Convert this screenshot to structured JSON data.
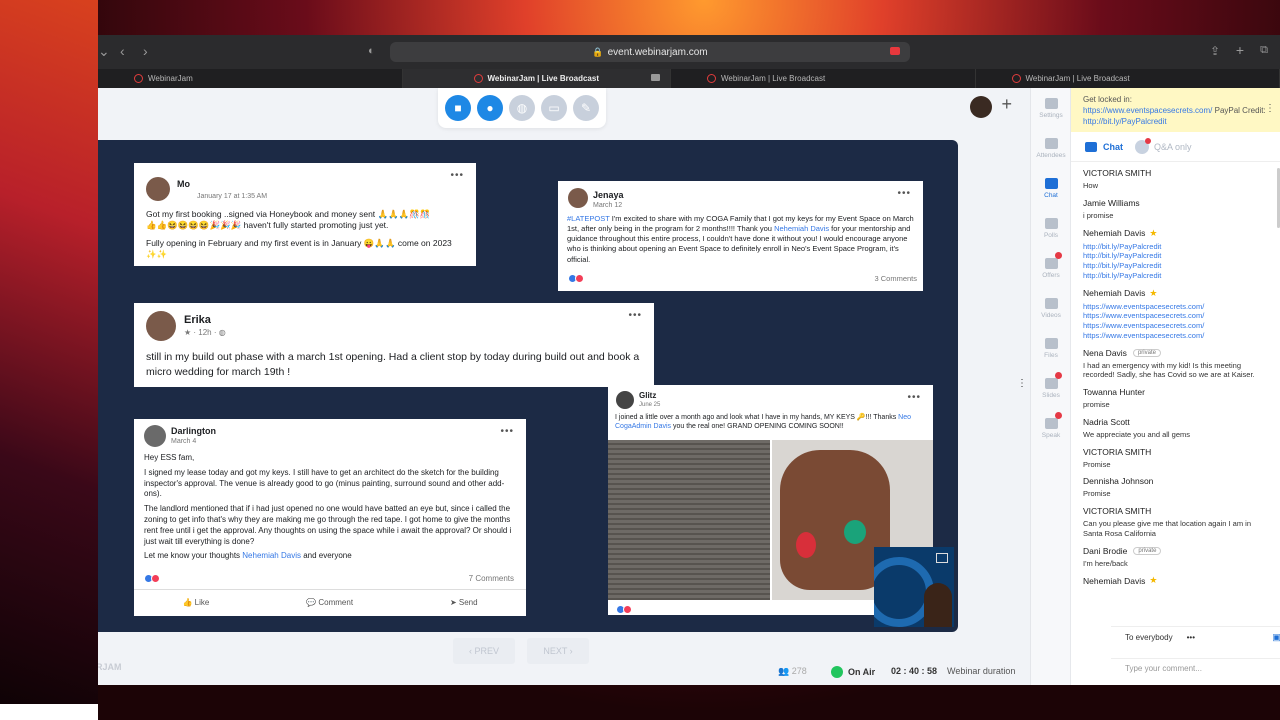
{
  "browser": {
    "url": "event.webinarjam.com",
    "tabs": [
      "WebinarJam",
      "WebinarJam | Live Broadcast",
      "WebinarJam | Live Broadcast",
      "WebinarJam | Live Broadcast"
    ]
  },
  "posts": {
    "mo": {
      "name": "Mo",
      "date": "January 17 at 1:35 AM",
      "line1": "Got my first booking ..signed via Honeybook and money sent 🙏🙏🙏🎊🎊",
      "line2": "👍👍😆😆😆😆🎉🎉🎉 haven't fully started promoting just yet.",
      "line3": "Fully opening in February and my first event is in January 😛🙏🙏 come on 2023 ✨✨"
    },
    "jenaya": {
      "name": "Jenaya",
      "date": "March 12",
      "tag": "#LATEPOST",
      "text1": " I'm excited to share with my COGA Family that I got my keys for my Event Space on March 1st, after only being in the program for 2 months!!!! Thank you ",
      "mention": "Nehemiah Davis",
      "text2": " for your mentorship and guidance throughout this entire process, I couldn't have done it without you! I would encourage anyone who is thinking about opening an Event Space to definitely enroll in Neo's Event Space Program,  it's official.",
      "comments": "3 Comments"
    },
    "erika": {
      "name": "Erika",
      "date": "12h",
      "text": "still in my build out phase with a march 1st opening. Had a client stop by today during build out and book a micro wedding for march 19th !"
    },
    "darlington": {
      "name": "Darlington",
      "date": "March 4",
      "p1": "Hey ESS fam,",
      "p2": "I signed my lease today and got my keys. I still have to get an architect do the sketch for the building inspector's approval. The venue is already good to go (minus painting, surround sound and other add-ons).",
      "p3": "The landlord mentioned that if i had just opened no one would have batted an eye but, since i called the zoning to get info that's why they are making me go through the red tape. I got home to give the months rent free until i get the approval.  Any thoughts on using the space while i await the approval? Or should i just wait till everything is done?",
      "p4a": "Let me know your thoughts  ",
      "mention": "Nehemiah Davis",
      "p4b": " and everyone",
      "comments": "7 Comments",
      "like": "Like",
      "comment": "Comment",
      "send": "Send"
    },
    "glitz": {
      "name": "Glitz",
      "date": "June 25",
      "text1": "I joined a little over a month ago and look what I have in my hands, MY KEYS 🔑!!! Thanks ",
      "mention": "Neo CogaAdmin Davis",
      "text2": " you the real one! GRAND OPENING COMING SOON!!"
    }
  },
  "bottom": {
    "prev": "PREV",
    "next": "NEXT",
    "count": "278",
    "onair": "On Air",
    "timer": "02 : 40 : 58",
    "duration": "Webinar duration",
    "brand": "RJAM"
  },
  "sidebar": [
    "Settings",
    "Attendees",
    "Chat",
    "Polls",
    "Offers",
    "Videos",
    "Files",
    "Slides",
    "Speak"
  ],
  "notice": {
    "label": "Get locked in:",
    "url1": "https://www.eventspacesecrets.com/",
    "mid": " PayPal Credit: ",
    "url2": "http://bit.ly/PayPalcredit"
  },
  "chat_tabs": {
    "chat": "Chat",
    "qa": "Q&A only"
  },
  "messages": [
    {
      "name": "VICTORIA SMITH",
      "text": "How"
    },
    {
      "name": "Jamie Williams",
      "text": "i promise"
    },
    {
      "name": "Nehemiah Davis",
      "text": "http://bit.ly/PayPalcredit\nhttp://bit.ly/PayPalcredit\nhttp://bit.ly/PayPalcredit\nhttp://bit.ly/PayPalcredit"
    },
    {
      "name": "Nehemiah Davis",
      "text": "https://www.eventspacesecrets.com/\nhttps://www.eventspacesecrets.com/\nhttps://www.eventspacesecrets.com/\nhttps://www.eventspacesecrets.com/"
    },
    {
      "name": "Nena Davis",
      "badge": "private",
      "text": "I had an emergency with my kid! Is this meeting recorded! Sadly, she has Covid so we are at Kaiser."
    },
    {
      "name": "Towanna Hunter",
      "text": "promise"
    },
    {
      "name": "Nadria Scott",
      "text": "We appreciate you and all gems"
    },
    {
      "name": "VICTORIA SMITH",
      "text": "Promise"
    },
    {
      "name": "Dennisha Johnson",
      "text": "Promise"
    },
    {
      "name": "VICTORIA SMITH",
      "text": "Can you please give me that location again I am in Santa Rosa California"
    },
    {
      "name": "Dani Brodie",
      "badge": "private",
      "text": "I'm here/back"
    },
    {
      "name": "Nehemiah Davis",
      "text": ""
    }
  ],
  "chat_footer": {
    "to": "To everybody",
    "placeholder": "Type your comment..."
  }
}
